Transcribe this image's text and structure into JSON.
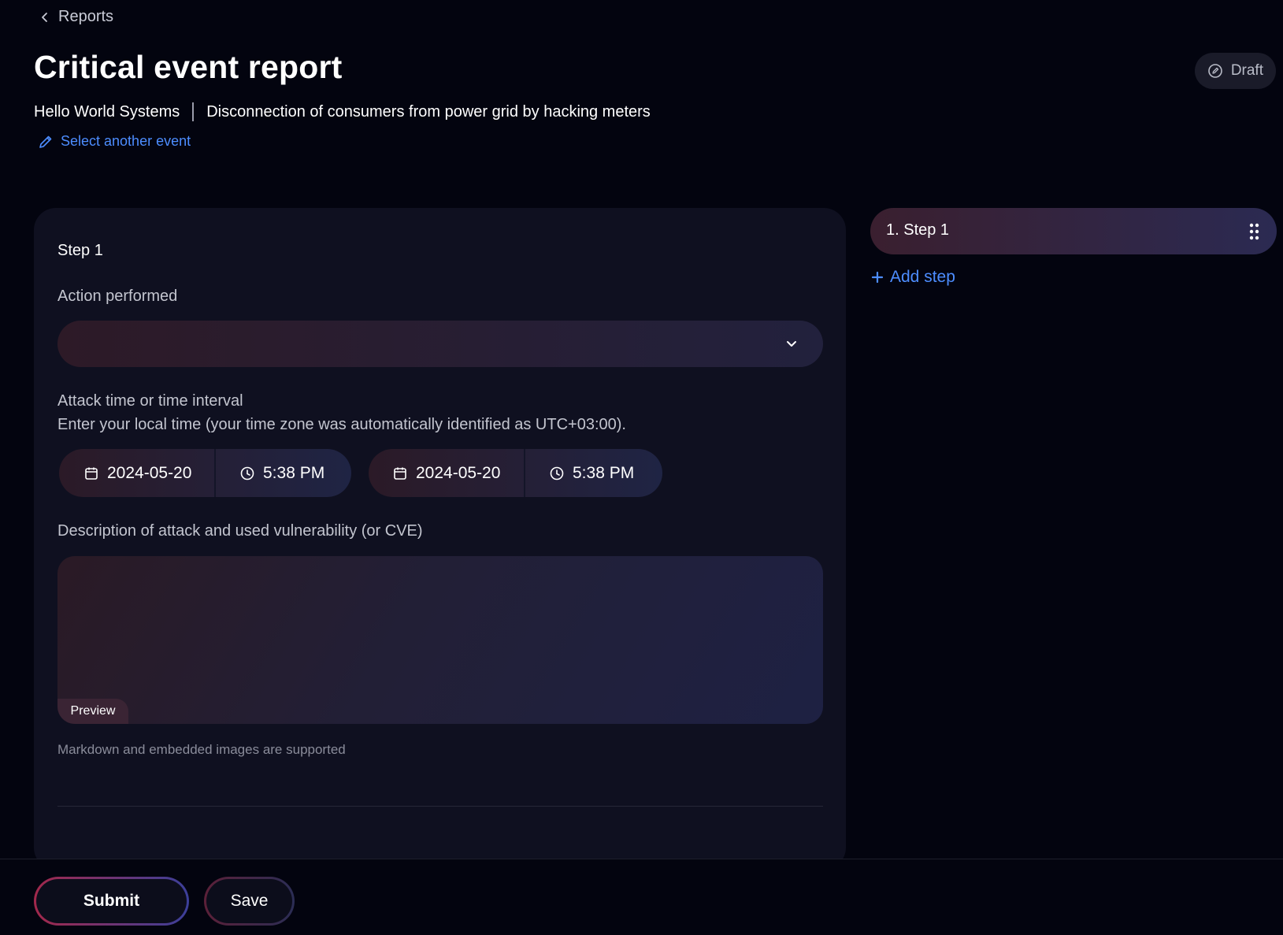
{
  "header": {
    "breadcrumb": "Reports",
    "title": "Critical event report",
    "status": "Draft",
    "organization": "Hello World Systems",
    "event_name": "Disconnection of consumers from power grid by hacking meters",
    "select_event_link": "Select another event"
  },
  "form": {
    "step_title": "Step 1",
    "action_label": "Action performed",
    "action_value": "",
    "time_label": "Attack time or time interval",
    "time_hint": "Enter your local time (your time zone was automatically identified as UTC+03:00).",
    "start": {
      "date": "2024-05-20",
      "time": "5:38 PM"
    },
    "end": {
      "date": "2024-05-20",
      "time": "5:38 PM"
    },
    "description_label": "Description of attack and used vulnerability (or CVE)",
    "preview_tab": "Preview",
    "markdown_hint": "Markdown and embedded images are supported"
  },
  "steps_panel": {
    "steps": [
      {
        "label": "1. Step 1"
      }
    ],
    "add_step": "Add step"
  },
  "footer": {
    "submit_label": "Submit",
    "save_label": "Save"
  },
  "colors": {
    "background": "#03040f",
    "card": "#0f1020",
    "link": "#4d8dff"
  }
}
